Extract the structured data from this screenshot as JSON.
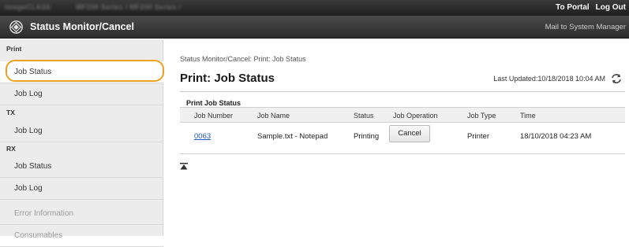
{
  "topbar": {
    "device_name": "imageCLASS",
    "model_path": "MF200 Series / MF200 Series /",
    "links": [
      "To Portal",
      "Log Out"
    ]
  },
  "titlebar": {
    "title": "Status Monitor/Cancel",
    "mail_link": "Mail to System Manager"
  },
  "sidebar": {
    "print_header": "Print",
    "print_items": [
      "Job Status",
      "Job Log"
    ],
    "tx_header": "TX",
    "tx_items": [
      "Job Log"
    ],
    "rx_header": "RX",
    "rx_items": [
      "Job Status",
      "Job Log"
    ],
    "extra_items": [
      "Error Information",
      "Consumables"
    ],
    "selected_item": "Job Status"
  },
  "main": {
    "breadcrumb": "Status Monitor/Cancel: Print: Job Status",
    "page_title": "Print: Job Status",
    "last_updated": "Last Updated:10/18/2018 10:04 AM",
    "section_label": "Print Job Status",
    "columns": [
      "Job Number",
      "Job Name",
      "Status",
      "Job Operation",
      "Job Type",
      "Time"
    ],
    "row": {
      "job_number": "0063",
      "job_name": "Sample.txt - Notepad",
      "status": "Printing",
      "operation_button": "Cancel",
      "job_type": "Printer",
      "time": "18/10/2018 04:23 AM"
    }
  },
  "colors": {
    "highlight": "#f0a020",
    "link": "#2255bb",
    "header_bg": "#2c2c2c",
    "sidebar_bg": "#ececec"
  }
}
